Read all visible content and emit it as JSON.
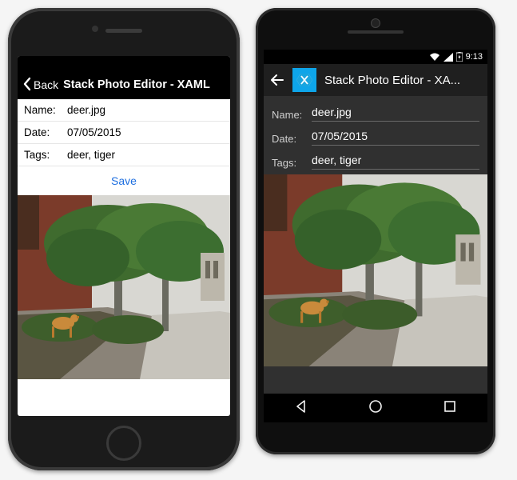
{
  "ios": {
    "nav": {
      "back_label": "Back",
      "title": "Stack Photo Editor - XAML"
    },
    "form": {
      "name_label": "Name:",
      "name_value": "deer.jpg",
      "date_label": "Date:",
      "date_value": "07/05/2015",
      "tags_label": "Tags:",
      "tags_value": "deer, tiger",
      "save_label": "Save"
    }
  },
  "android": {
    "status": {
      "time": "9:13"
    },
    "bar": {
      "title": "Stack Photo Editor - XA..."
    },
    "form": {
      "name_label": "Name:",
      "name_value": "deer.jpg",
      "date_label": "Date:",
      "date_value": "07/05/2015",
      "tags_label": "Tags:",
      "tags_value": "deer, tiger"
    },
    "keys": {
      "back": "back",
      "home": "home",
      "recents": "recents"
    }
  }
}
